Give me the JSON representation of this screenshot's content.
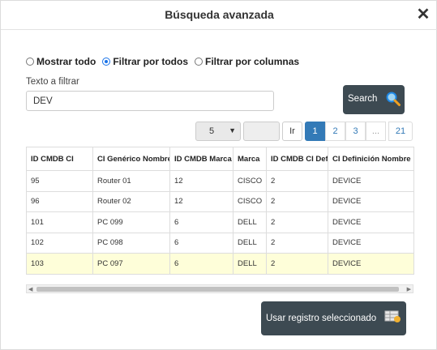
{
  "dialog": {
    "title": "Búsqueda avanzada",
    "close_symbol": "✕"
  },
  "filter_mode": {
    "options": [
      {
        "label": "Mostrar todo",
        "checked": false
      },
      {
        "label": "Filtrar por todos",
        "checked": true
      },
      {
        "label": "Filtrar por columnas",
        "checked": false
      }
    ]
  },
  "filter": {
    "label": "Texto a filtrar",
    "value": "DEV"
  },
  "search_button": {
    "label": "Search",
    "icon": "magnifier-icon"
  },
  "pagination": {
    "page_size": "5",
    "goto_value": "",
    "goto_label": "Ir",
    "pages": [
      "1",
      "2",
      "3",
      "...",
      "21"
    ],
    "current": "1",
    "active_color": "#337ab7"
  },
  "table": {
    "columns": [
      "ID CMDB CI",
      "CI Genérico Nombre",
      "ID CMDB Marca",
      "Marca",
      "ID CMDB CI Definición",
      "CI Definición Nombre"
    ],
    "rows": [
      [
        "95",
        "Router 01",
        "12",
        "CISCO",
        "2",
        "DEVICE"
      ],
      [
        "96",
        "Router 02",
        "12",
        "CISCO",
        "2",
        "DEVICE"
      ],
      [
        "101",
        "PC 099",
        "6",
        "DELL",
        "2",
        "DEVICE"
      ],
      [
        "102",
        "PC 098",
        "6",
        "DELL",
        "2",
        "DEVICE"
      ],
      [
        "103",
        "PC 097",
        "6",
        "DELL",
        "2",
        "DEVICE"
      ]
    ],
    "selected_row": 4,
    "selected_color": "#fefed9"
  },
  "use_button": {
    "label": "Usar registro seleccionado",
    "icon": "table-select-icon"
  },
  "colors": {
    "button_bg": "#3d4a52",
    "accent": "#337ab7"
  }
}
